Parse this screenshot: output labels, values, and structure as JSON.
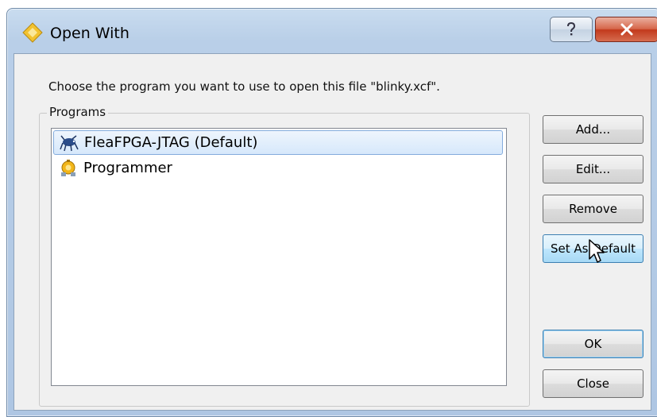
{
  "window": {
    "title": "Open With",
    "icon": "app-diamond-icon",
    "controls": {
      "help": "help-icon",
      "close": "close-icon"
    }
  },
  "dialog": {
    "prompt": "Choose the program you want to use to open this file \"blinky.xcf\".",
    "group_label": "Programs",
    "programs": [
      {
        "label": "FleaFPGA-JTAG (Default)",
        "icon": "flea-icon",
        "selected": true
      },
      {
        "label": "Programmer",
        "icon": "programmer-icon",
        "selected": false
      }
    ],
    "buttons": {
      "add": "Add...",
      "edit": "Edit...",
      "remove": "Remove",
      "set_default": "Set As Default",
      "ok": "OK",
      "close": "Close"
    }
  },
  "colors": {
    "titlebar": "#b9cfe8",
    "selection": "#d6e8fb",
    "close_button": "#c2391c",
    "hot_button": "#bee6fd"
  }
}
